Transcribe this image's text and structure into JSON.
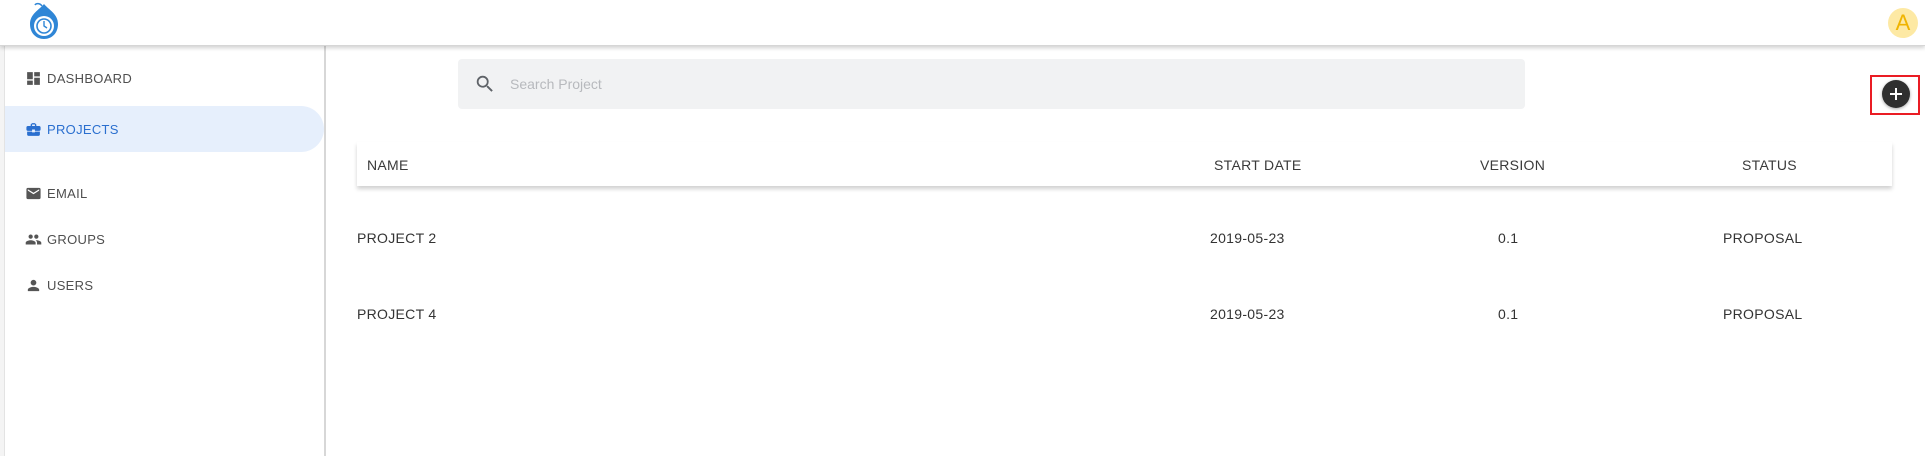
{
  "header": {
    "avatar_letter": "A"
  },
  "sidebar": {
    "items": [
      {
        "label": "DASHBOARD",
        "icon": "dashboard-icon",
        "active": false
      },
      {
        "label": "PROJECTS",
        "icon": "briefcase-icon",
        "active": true
      },
      {
        "label": "EMAIL",
        "icon": "mail-icon",
        "active": false
      },
      {
        "label": "GROUPS",
        "icon": "groups-icon",
        "active": false
      },
      {
        "label": "USERS",
        "icon": "user-icon",
        "active": false
      }
    ]
  },
  "search": {
    "placeholder": "Search Project",
    "value": ""
  },
  "add_button": {
    "icon": "plus-icon"
  },
  "table": {
    "columns": [
      "NAME",
      "START DATE",
      "VERSION",
      "STATUS"
    ],
    "rows": [
      {
        "name": "PROJECT 2",
        "start_date": "2019-05-23",
        "version": "0.1",
        "status": "PROPOSAL"
      },
      {
        "name": "PROJECT 4",
        "start_date": "2019-05-23",
        "version": "0.1",
        "status": "PROPOSAL"
      }
    ]
  },
  "colors": {
    "accent": "#2a6fcf",
    "active_bg": "#e6effc",
    "highlight": "#ea1c24",
    "avatar_bg": "#fde9a4",
    "avatar_fg": "#f0b400"
  }
}
